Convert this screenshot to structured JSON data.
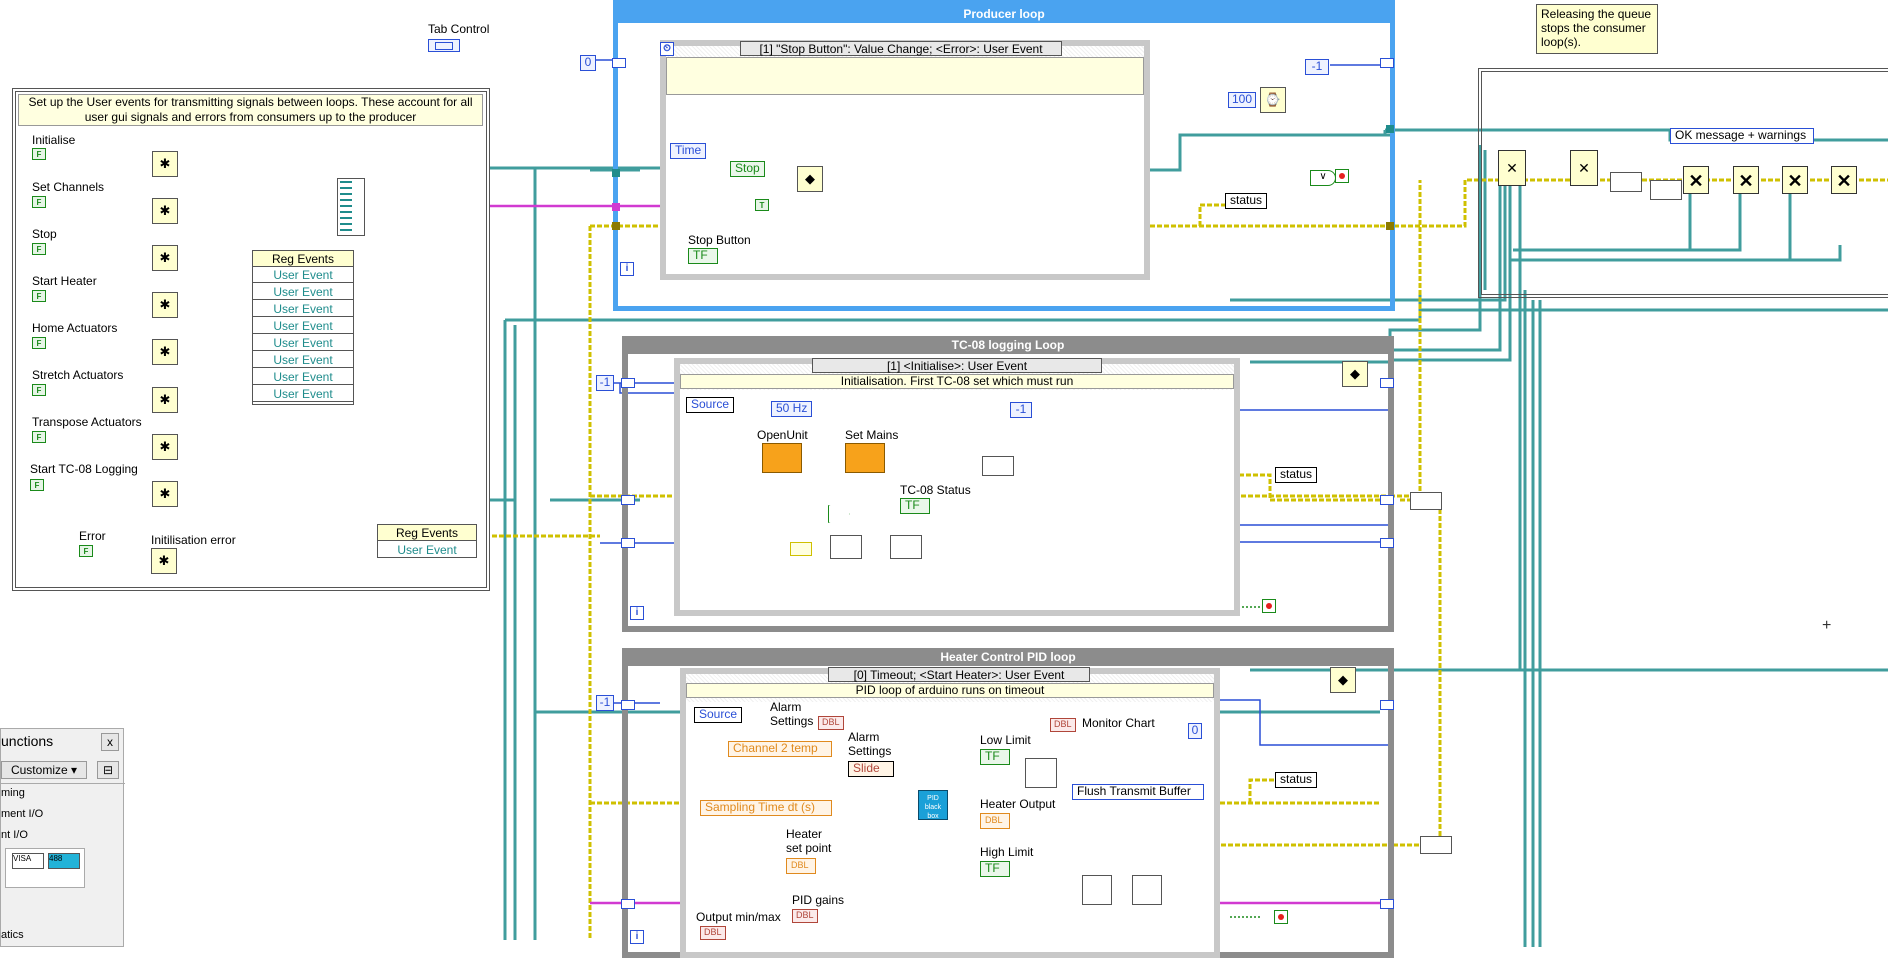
{
  "tab_control_label": "Tab Control",
  "note_release": "Releasing the queue stops the consumer loop(s).",
  "setup_box": {
    "description": "Set up the User events for transmitting signals between loops. These account for all user gui signals and errors from consumers up to the producer",
    "controls": [
      "Initialise",
      "Set Channels",
      "Stop",
      "Start Heater",
      "Home Actuators",
      "Stretch Actuators",
      "Transpose Actuators",
      "Start TC-08 Logging"
    ],
    "error_label": "Error",
    "init_error_label": "Initilisation error",
    "reg_events_label": "Reg Events",
    "user_event_label": "User Event",
    "user_event_rows": [
      "User Event",
      "User Event",
      "User Event",
      "User Event",
      "User Event",
      "User Event",
      "User Event",
      "User Event"
    ],
    "reg_events_2_label": "Reg Events",
    "user_event_2_label": "User Event"
  },
  "producer": {
    "title": "Producer loop",
    "selector": "[1] \"Stop Button\": Value Change; <Error>: User Event",
    "const_0": "0",
    "const_neg1": "-1",
    "const_100": "100",
    "time_label": "Time",
    "stop_label": "Stop",
    "status_label": "status",
    "stop_button_label": "Stop Button",
    "true_const": "T",
    "tf": "TF",
    "iter": "i"
  },
  "tc08": {
    "title": "TC-08 logging Loop",
    "selector": "[1] <Initialise>: User Event",
    "description": "Initialisation. First TC-08 set which must run",
    "const_neg1_a": "-1",
    "const_neg1_b": "-1",
    "source_label": "Source",
    "hz_label": "50 Hz",
    "openunit_label": "OpenUnit",
    "setmains_label": "Set Mains",
    "tc08_status_label": "TC-08 Status",
    "status_label": "status",
    "tf": "TF",
    "iter": "i"
  },
  "heater": {
    "title": "Heater Control PID loop",
    "selector": "[0] Timeout; <Start Heater>: User Event",
    "description": "PID loop of arduino runs on timeout",
    "const_neg1": "-1",
    "const_0": "0",
    "source_label": "Source",
    "alarm_settings_1": "Alarm Settings",
    "alarm_settings_2": "Alarm Settings",
    "channel2_label": "Channel 2 temp",
    "slide_label": "Slide",
    "sampling_label": "Sampling Time dt (s)",
    "heater_setpoint_label": "Heater set point",
    "pid_gains_label": "PID gains",
    "output_minmax_label": "Output min/max",
    "low_limit_label": "Low Limit",
    "high_limit_label": "High Limit",
    "heater_output_label": "Heater Output",
    "monitor_chart_label": "Monitor Chart",
    "flush_label": "Flush Transmit Buffer",
    "status_label": "status",
    "pid_block_label": "PID black box",
    "dbl": "DBL",
    "tf": "TF",
    "iter": "i"
  },
  "consumer_right": {
    "ok_msg_label": "OK message + warnings"
  },
  "palette": {
    "title": "unctions",
    "customize": "Customize",
    "items": [
      "ming",
      "ment I/O",
      "nt I/O",
      "atics"
    ]
  },
  "colors": {
    "teal_wire": "#1f8c8c",
    "yellow_wire": "#cfc000",
    "blue_wire": "#2a4fd6",
    "pink_wire": "#d13ad1",
    "orange_wire": "#e08a1e",
    "brown_wire": "#b0463a",
    "green_wire": "#1a8a1a"
  }
}
